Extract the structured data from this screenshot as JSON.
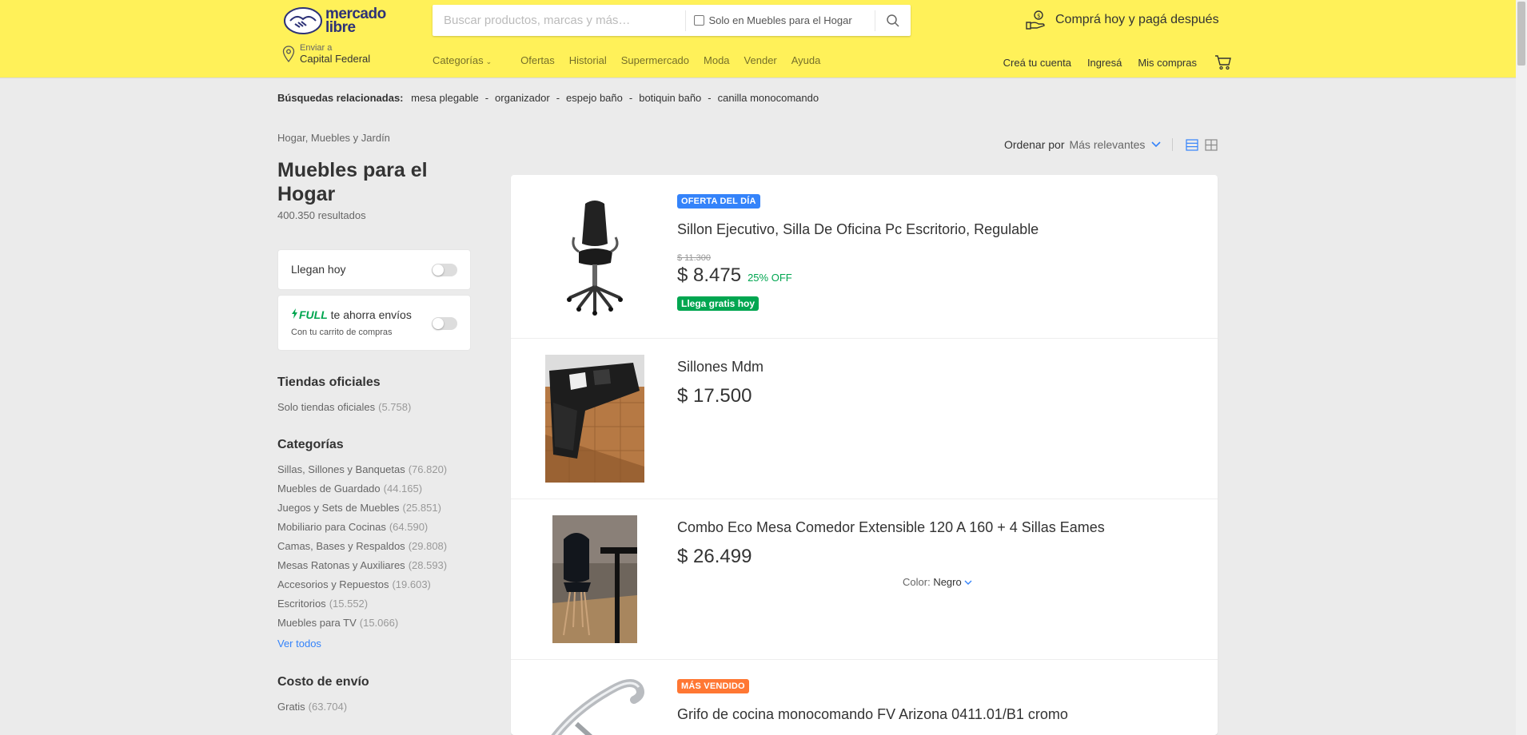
{
  "header": {
    "logo_line1": "mercado",
    "logo_line2": "libre",
    "search_placeholder": "Buscar productos, marcas y más…",
    "search_scope": "Solo en Muebles para el Hogar",
    "promo": "Comprá hoy y pagá después",
    "ship_label": "Enviar a",
    "ship_location": "Capital Federal",
    "nav": [
      "Categorías",
      "Ofertas",
      "Historial",
      "Supermercado",
      "Moda",
      "Vender",
      "Ayuda"
    ],
    "user_nav": [
      "Creá tu cuenta",
      "Ingresá",
      "Mis compras"
    ]
  },
  "related": {
    "label": "Búsquedas relacionadas:",
    "items": [
      "mesa plegable",
      "organizador",
      "espejo baño",
      "botiquin baño",
      "canilla monocomando"
    ]
  },
  "sidebar": {
    "breadcrumb": "Hogar, Muebles y Jardín",
    "title": "Muebles para el Hogar",
    "results": "400.350 resultados",
    "llegan_hoy": "Llegan hoy",
    "full_brand": "FULL",
    "full_text": "te ahorra envíos",
    "full_sub": "Con tu carrito de compras",
    "tiendas_title": "Tiendas oficiales",
    "tiendas_item": {
      "label": "Solo tiendas oficiales",
      "count": "(5.758)"
    },
    "categorias_title": "Categorías",
    "categorias": [
      {
        "label": "Sillas, Sillones y Banquetas",
        "count": "(76.820)"
      },
      {
        "label": "Muebles de Guardado",
        "count": "(44.165)"
      },
      {
        "label": "Juegos y Sets de Muebles",
        "count": "(25.851)"
      },
      {
        "label": "Mobiliario para Cocinas",
        "count": "(64.590)"
      },
      {
        "label": "Camas, Bases y Respaldos",
        "count": "(29.808)"
      },
      {
        "label": "Mesas Ratonas y Auxiliares",
        "count": "(28.593)"
      },
      {
        "label": "Accesorios y Repuestos",
        "count": "(19.603)"
      },
      {
        "label": "Escritorios",
        "count": "(15.552)"
      },
      {
        "label": "Muebles para TV",
        "count": "(15.066)"
      }
    ],
    "ver_todos": "Ver todos",
    "costo_title": "Costo de envío",
    "costo_item": {
      "label": "Gratis",
      "count": "(63.704)"
    }
  },
  "sort": {
    "label": "Ordenar por",
    "value": "Más relevantes"
  },
  "items": [
    {
      "badge": "OFERTA DEL DÍA",
      "title": "Sillon Ejecutivo, Silla De Oficina Pc Escritorio, Regulable",
      "old_price": "$ 11.300",
      "price": "$ 8.475",
      "off": "25% OFF",
      "shipping": "Llega gratis hoy"
    },
    {
      "title": "Sillones Mdm",
      "price": "$ 17.500"
    },
    {
      "title": "Combo Eco Mesa Comedor Extensible 120 A 160 + 4 Sillas Eames",
      "price": "$ 26.499",
      "attr_label": "Color:",
      "attr_value": "Negro"
    },
    {
      "badge": "MÁS VENDIDO",
      "title": "Grifo de cocina monocomando FV Arizona 0411.01/B1 cromo"
    }
  ],
  "colors": {
    "header_bg": "#fff159",
    "accent_blue": "#3483fa",
    "green": "#00a650",
    "orange_badge": "#ff7733"
  }
}
